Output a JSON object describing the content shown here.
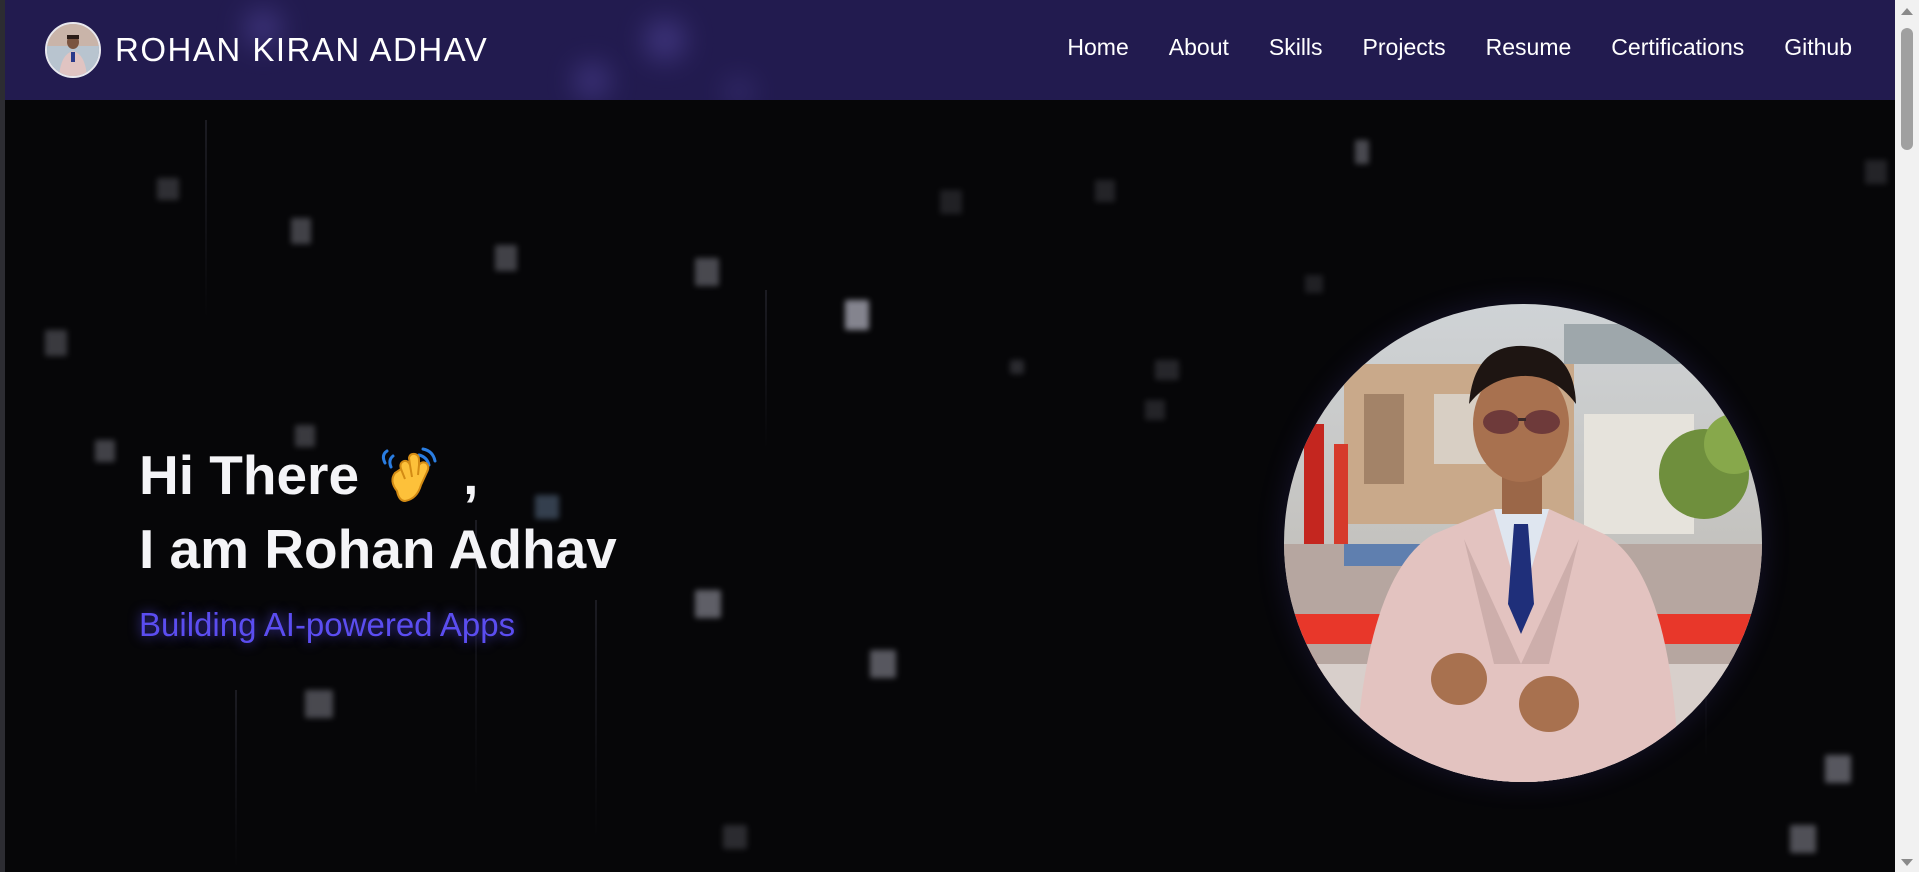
{
  "header": {
    "brand_name": "ROHAN KIRAN ADHAV",
    "avatar_icon": "profile-avatar",
    "nav": [
      {
        "label": "Home"
      },
      {
        "label": "About"
      },
      {
        "label": "Skills"
      },
      {
        "label": "Projects"
      },
      {
        "label": "Resume"
      },
      {
        "label": "Certifications"
      },
      {
        "label": "Github"
      }
    ]
  },
  "hero": {
    "greeting": "Hi There",
    "wave_icon": "waving-hand-icon",
    "comma": ",",
    "intro": "I am Rohan Adhav",
    "tagline": "Building AI-powered Apps",
    "portrait_icon": "profile-photo"
  },
  "colors": {
    "navbar": "#221b4f",
    "background": "#060608",
    "accent": "#5b4df0",
    "text": "#ffffff"
  }
}
